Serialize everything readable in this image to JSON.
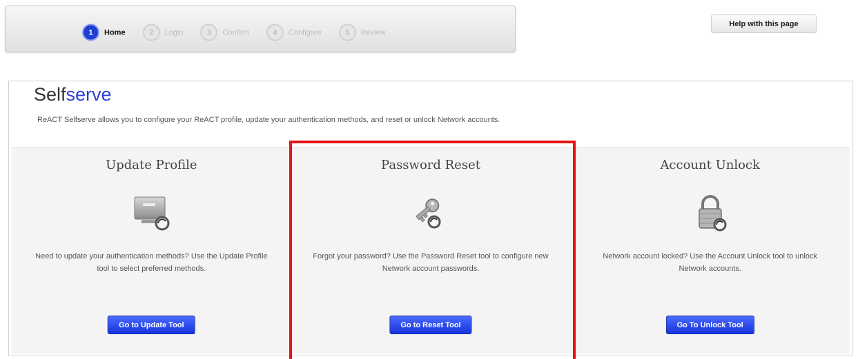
{
  "stepper": {
    "steps": [
      {
        "num": "1",
        "label": "Home",
        "state": "active"
      },
      {
        "num": "2",
        "label": "Login",
        "state": "inactive"
      },
      {
        "num": "3",
        "label": "Confirm",
        "state": "inactive"
      },
      {
        "num": "4",
        "label": "Configure",
        "state": "inactive"
      },
      {
        "num": "5",
        "label": "Review",
        "state": "inactive"
      }
    ]
  },
  "help_label": "Help with this page",
  "page": {
    "title_plain": "Self",
    "title_highlight": "serve",
    "intro": "ReACT Selfserve allows you to configure your ReACT profile, update your authentication methods, and reset or unlock Network accounts."
  },
  "cards": [
    {
      "title": "Update Profile",
      "icon": "monitor-sync-icon",
      "description": "Need to update your authentication methods? Use the Update Profile tool to select preferred methods.",
      "button": "Go to Update Tool"
    },
    {
      "title": "Password Reset",
      "icon": "key-sync-icon",
      "description": "Forgot your password? Use the Password Reset tool to configure new Network account passwords.",
      "button": "Go to Reset Tool"
    },
    {
      "title": "Account Unlock",
      "icon": "padlock-sync-icon",
      "description": "Network account locked? Use the Account Unlock tool to unlock Network accounts.",
      "button": "Go To Unlock Tool"
    }
  ],
  "colors": {
    "accent_blue": "#1e3fd2",
    "button_blue": "#2b47e8",
    "highlight_red": "#e41414"
  }
}
